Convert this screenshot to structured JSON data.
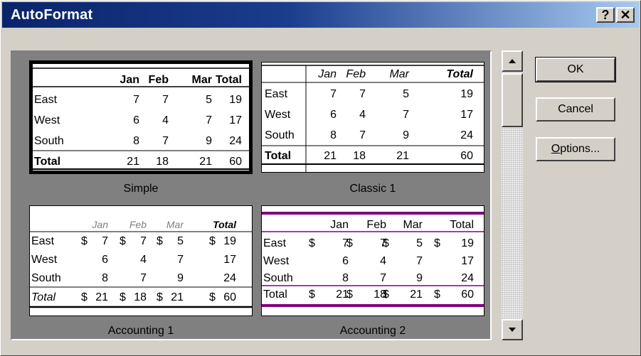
{
  "title": "AutoFormat",
  "help_glyph": "?",
  "close_glyph": "✕",
  "buttons": {
    "ok": "OK",
    "cancel": "Cancel",
    "options": "Options..."
  },
  "row_labels": [
    "East",
    "West",
    "South"
  ],
  "total_label": "Total",
  "months": [
    "Jan",
    "Feb",
    "Mar"
  ],
  "rows": [
    [
      7,
      7,
      5,
      19
    ],
    [
      6,
      4,
      7,
      17
    ],
    [
      8,
      7,
      9,
      24
    ]
  ],
  "totals": [
    21,
    18,
    21,
    60
  ],
  "currency_symbol": "$",
  "formats": [
    {
      "name": "Simple",
      "selected": true
    },
    {
      "name": "Classic 1",
      "selected": false
    },
    {
      "name": "Accounting 1",
      "selected": false
    },
    {
      "name": "Accounting 2",
      "selected": false
    }
  ],
  "colors": {
    "accent_purple": "#800080",
    "title_bar": "#0a246a",
    "muted_header": "#808080"
  }
}
